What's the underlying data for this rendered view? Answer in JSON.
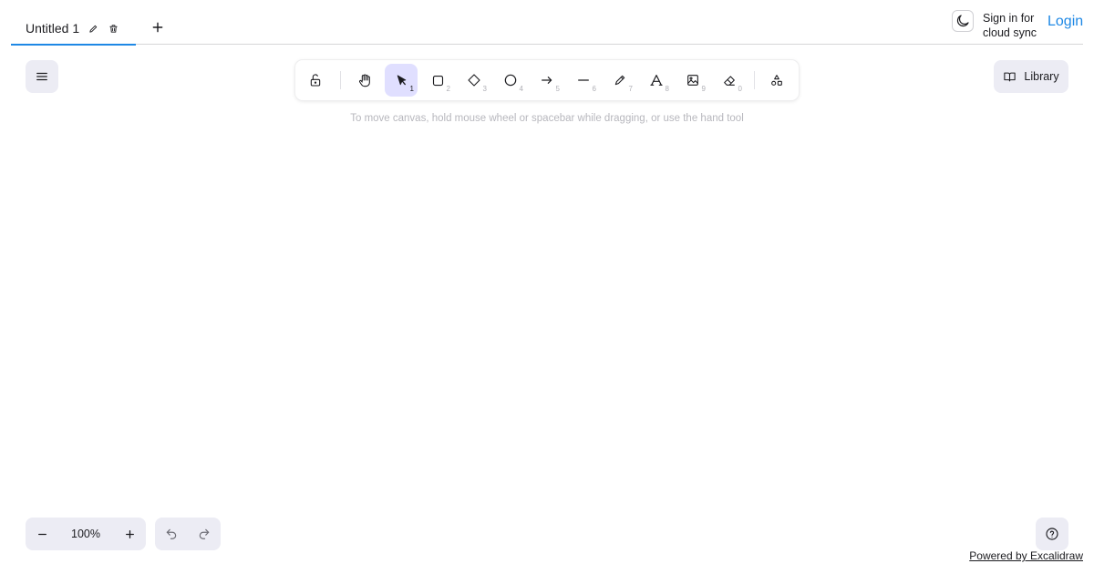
{
  "tabs": [
    {
      "title": "Untitled 1",
      "active": true,
      "edit_icon": "pencil-icon",
      "delete_icon": "trash-icon"
    }
  ],
  "tab_add_icon": "plus-icon",
  "header": {
    "theme_icon": "moon-icon",
    "signin_text": "Sign in for cloud sync",
    "login_label": "Login"
  },
  "menu": {
    "icon": "hamburger-menu-icon"
  },
  "toolbar": {
    "tools": [
      {
        "name": "lock",
        "icon": "lock-icon",
        "key": ""
      },
      {
        "name": "hand",
        "icon": "hand-icon",
        "key": ""
      },
      {
        "name": "selection",
        "icon": "cursor-icon",
        "key": "1",
        "active": true
      },
      {
        "name": "rectangle",
        "icon": "rectangle-icon",
        "key": "2"
      },
      {
        "name": "diamond",
        "icon": "diamond-icon",
        "key": "3"
      },
      {
        "name": "ellipse",
        "icon": "circle-icon",
        "key": "4"
      },
      {
        "name": "arrow",
        "icon": "arrow-icon",
        "key": "5"
      },
      {
        "name": "line",
        "icon": "line-icon",
        "key": "6"
      },
      {
        "name": "draw",
        "icon": "pencil-icon",
        "key": "7"
      },
      {
        "name": "text",
        "icon": "text-icon",
        "key": "8"
      },
      {
        "name": "image",
        "icon": "image-icon",
        "key": "9"
      },
      {
        "name": "eraser",
        "icon": "eraser-icon",
        "key": "0"
      },
      {
        "name": "more-tools",
        "icon": "shapes-icon",
        "key": ""
      }
    ],
    "hint": "To move canvas, hold mouse wheel or spacebar while dragging, or use the hand tool"
  },
  "library": {
    "label": "Library",
    "icon": "book-icon"
  },
  "zoom": {
    "value": "100%",
    "minus_icon": "minus-icon",
    "plus_icon": "plus-icon"
  },
  "history": {
    "undo_icon": "undo-icon",
    "redo_icon": "redo-icon"
  },
  "help": {
    "icon": "question-icon"
  },
  "footer": {
    "powered_by": "Powered by Excalidraw"
  },
  "colors": {
    "accent": "#1e88e5",
    "active_tool_bg": "#e0dfff",
    "island_bg": "#ececf4"
  }
}
